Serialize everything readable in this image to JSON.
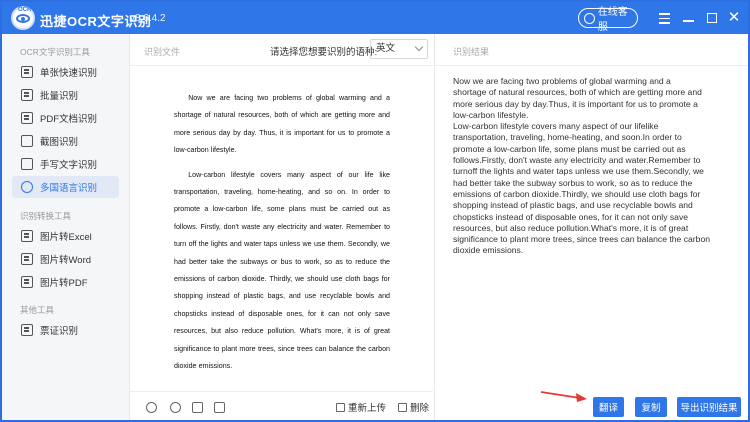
{
  "app": {
    "logo_text": "OCR",
    "name": "迅捷OCR文字识别",
    "version": "v8.6.4.2",
    "service_btn": "在线客服"
  },
  "sidebar": {
    "sections": [
      {
        "title": "OCR文字识别工具",
        "items": [
          "单张快速识别",
          "批量识别",
          "PDF文档识别",
          "截图识别",
          "手写文字识别",
          "多国语言识别"
        ]
      },
      {
        "title": "识别转换工具",
        "items": [
          "图片转Excel",
          "图片转Word",
          "图片转PDF"
        ]
      },
      {
        "title": "其他工具",
        "items": [
          "票证识别"
        ]
      }
    ],
    "active_item": "多国语言识别"
  },
  "middle": {
    "title": "识别文件",
    "lang_label": "请选择您想要识别的语种:",
    "lang_value": "英文",
    "doc_paragraphs": [
      "Now we are facing two problems of global warming and a shortage of natural resources, both of which are getting more and more serious day by day. Thus, it is important for us to promote a low-carbon lifestyle.",
      "Low-carbon lifestyle covers many aspect of our life like transportation, traveling, home-heating, and so on. In order to promote a low-carbon life, some plans must be carried out as follows. Firstly, don't waste any electricity and water. Remember to turn off the lights and water taps unless we use them. Secondly, we had better take the subways or bus to work, so as to reduce the emissions of carbon dioxide. Thirdly, we should use cloth bags for shopping instead of plastic bags, and use recyclable bowls and chopsticks instead of disposable ones, for it can not only save resources, but also reduce pollution. What's more, it is of great significance to plant more trees, since trees can balance the carbon dioxide emissions."
    ],
    "reupload": "重新上传",
    "delete": "删除"
  },
  "right": {
    "title": "识别结果",
    "result_lines": [
      "Now we are facing two problems of global warming and a",
      "shortage of natural resources,  both of which are getting more and",
      "more serious day by day.Thus,  it is important for us to promote a",
      "low-carbon lifestyle.",
      "Low-carbon lifestyle covers many aspect of our lifelike",
      "transportation,  traveling,  home-heating,  and soon.In order to",
      "promote a low-carbon life,  some plans must be carried out as",
      "follows.Firstly,  don't waste any electricity and water.Remember to",
      "turnoff the lights and water taps unless we use them.Secondly,  we",
      "had better take the subway sorbus to work,  so as to reduce the",
      "emissions of carbon dioxide.Thirdly,  we should use cloth bags for",
      "shopping instead of plastic bags,  and use recyclable bowls and",
      "chopsticks instead of disposable ones,  for it can not only save",
      "resources,  but also reduce pollution.What's more,  it is of great",
      "significance to plant more trees,  since trees can balance the carbon",
      "dioxide emissions."
    ],
    "translate_btn": "翻译",
    "copy_btn": "复制",
    "export_btn": "导出识别结果"
  },
  "colors": {
    "accent": "#2f76e8",
    "arrow": "#e53935"
  }
}
